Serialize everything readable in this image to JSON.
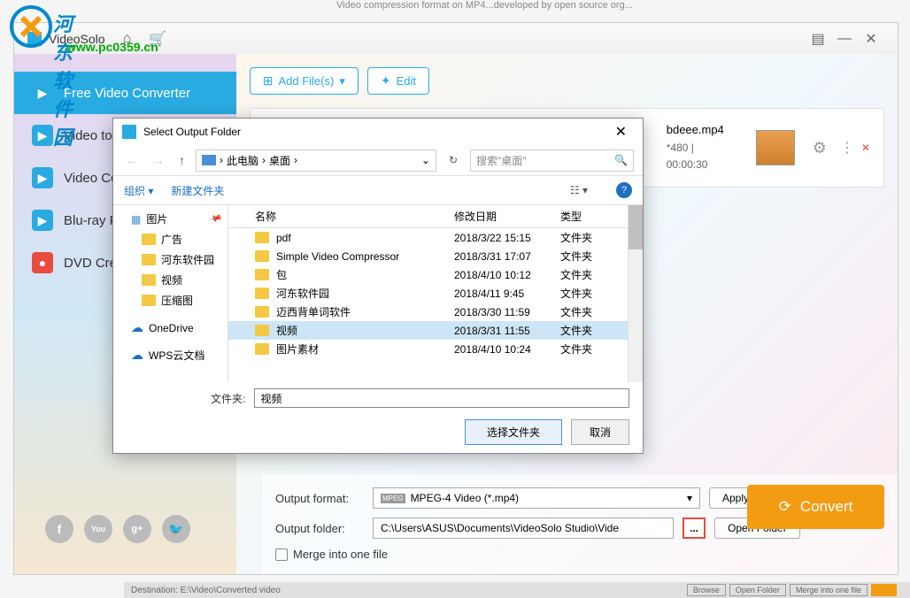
{
  "watermark": {
    "text": "河东软件园",
    "url": "www.pc0359.cn"
  },
  "top_clip": "Video compression format on MP4...developed by open source org...",
  "titlebar": {
    "app_name": "VideoSolo",
    "minimize": "—",
    "close": "✕"
  },
  "sidebar": {
    "items": [
      {
        "label": "Free Video Converter"
      },
      {
        "label": "Video to GIF"
      },
      {
        "label": "Video Conve"
      },
      {
        "label": "Blu-ray Playe"
      },
      {
        "label": "DVD Creator"
      }
    ]
  },
  "toolbar": {
    "add_file": "Add File(s)",
    "edit": "Edit"
  },
  "file": {
    "name": "bdeee.mp4",
    "meta": "*480 | 00:00:30"
  },
  "output": {
    "format_label": "Output format:",
    "format_value": "MPEG-4 Video (*.mp4)",
    "folder_label": "Output folder:",
    "folder_value": "C:\\Users\\ASUS\\Documents\\VideoSolo Studio\\Vide",
    "apply": "Apply to all",
    "open": "Open Folder",
    "browse": "...",
    "merge": "Merge into one file",
    "convert": "Convert"
  },
  "footer": {
    "destination": "Destination:  E:\\Video\\Converted video",
    "browse": "Browse",
    "open": "Open Folder",
    "merge": "Merge into one file"
  },
  "dialog": {
    "title": "Select Output Folder",
    "breadcrumb": {
      "pc": "此电脑",
      "desktop": "桌面"
    },
    "search_placeholder": "搜索\"桌面\"",
    "organize": "组织",
    "new_folder": "新建文件夹",
    "tree": [
      {
        "label": "图片",
        "pinned": true
      },
      {
        "label": "广告",
        "indent": true
      },
      {
        "label": "河东软件园",
        "indent": true
      },
      {
        "label": "视频",
        "indent": true
      },
      {
        "label": "压缩图",
        "indent": true
      },
      {
        "label": "OneDrive",
        "cloud": true
      },
      {
        "label": "WPS云文档",
        "cloud": true
      }
    ],
    "columns": {
      "name": "名称",
      "date": "修改日期",
      "type": "类型"
    },
    "rows": [
      {
        "name": "pdf",
        "date": "2018/3/22 15:15",
        "type": "文件夹"
      },
      {
        "name": "Simple Video Compressor",
        "date": "2018/3/31 17:07",
        "type": "文件夹"
      },
      {
        "name": "包",
        "date": "2018/4/10 10:12",
        "type": "文件夹"
      },
      {
        "name": "河东软件园",
        "date": "2018/4/11 9:45",
        "type": "文件夹"
      },
      {
        "name": "迈西背单词软件",
        "date": "2018/3/30 11:59",
        "type": "文件夹"
      },
      {
        "name": "视频",
        "date": "2018/3/31 11:55",
        "type": "文件夹",
        "selected": true
      },
      {
        "name": "图片素材",
        "date": "2018/4/10 10:24",
        "type": "文件夹"
      }
    ],
    "folder_label": "文件夹:",
    "folder_value": "视频",
    "select_btn": "选择文件夹",
    "cancel_btn": "取消"
  }
}
